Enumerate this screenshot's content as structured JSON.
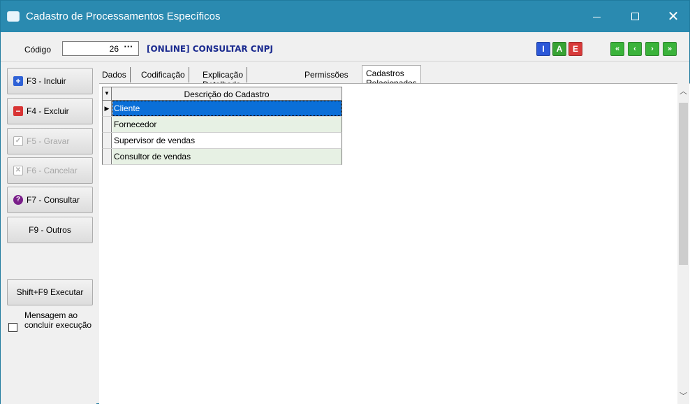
{
  "window": {
    "title": "Cadastro de Processamentos Específicos",
    "controls": {
      "minimize": "—",
      "maximize": "☐",
      "close": "✕"
    }
  },
  "toolbar": {
    "codigo_label": "Código",
    "codigo_value": "26",
    "codigo_button": "···",
    "process_name": "[ONLINE] CONSULTAR CNPJ",
    "buttons": {
      "i": "I",
      "a": "A",
      "e": "E",
      "first": "«",
      "prev": "‹",
      "next": "›",
      "last": "»"
    }
  },
  "actions": {
    "incluir": "F3 - Incluir",
    "excluir": "F4 - Excluir",
    "gravar": "F5 - Gravar",
    "cancelar": "F6 - Cancelar",
    "consultar": "F7 - Consultar",
    "outros": "F9 - Outros",
    "executar": "Shift+F9 Executar",
    "mensagem_label": "Mensagem ao concluir execução",
    "mensagem_checked": false
  },
  "tabs": [
    "Dados",
    "Codificação",
    "Explicação Detalhada",
    "Permissões",
    "Cadastros Relacionados"
  ],
  "active_tab": "Cadastros Relacionados",
  "grid": {
    "header_indicator": "▼",
    "column": "Descrição do Cadastro",
    "rows": [
      "Cliente",
      "Fornecedor",
      "Supervisor de vendas",
      "Consultor de vendas"
    ],
    "selected_indicator": "▶"
  },
  "colors": {
    "titlebar": "#2a8ab0",
    "selection": "#0a6fd8",
    "row_green": "#e7f1e4",
    "process_name": "#1a2a8f"
  }
}
